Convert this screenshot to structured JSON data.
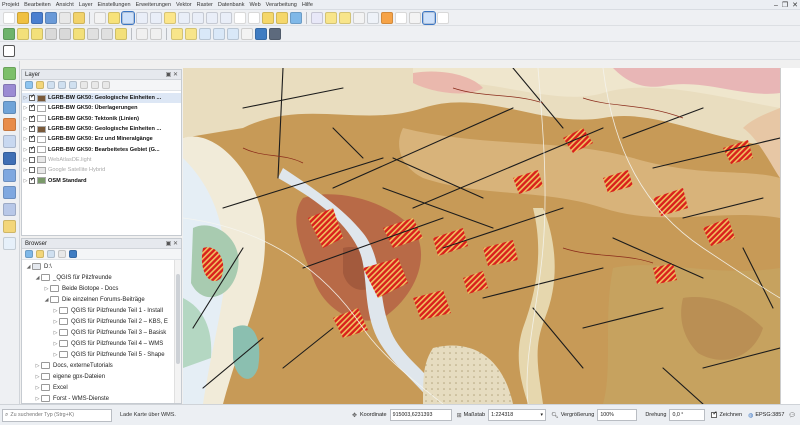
{
  "menu": [
    "Projekt",
    "Bearbeiten",
    "Ansicht",
    "Layer",
    "Einstellungen",
    "Erweiterungen",
    "Vektor",
    "Raster",
    "Datenbank",
    "Web",
    "Verarbeitung",
    "Hilfe"
  ],
  "window_controls": {
    "minimize": "–",
    "maximize": "❐",
    "close": "✕"
  },
  "layer_panel": {
    "title": "Layer",
    "controls": "▣ ✕",
    "layers": [
      {
        "label": "LGRB-BW GK50: Geologische Einheiten ...",
        "checked": true,
        "dim": false,
        "selected": true,
        "icon_color": "#7a5a3a"
      },
      {
        "label": "LGRB-BW GK50: Überlagerungen",
        "checked": true,
        "dim": false,
        "selected": false,
        "icon_color": "#ffffff"
      },
      {
        "label": "LGRB-BW GK50: Tektonik (Linien)",
        "checked": true,
        "dim": false,
        "selected": false,
        "icon_color": "#ffffff"
      },
      {
        "label": "LGRB-BW GK50: Geologische Einheiten ...",
        "checked": true,
        "dim": false,
        "selected": false,
        "icon_color": "#7a5a3a"
      },
      {
        "label": "LGRB-BW GK50: Erz und Mineralgänge",
        "checked": true,
        "dim": false,
        "selected": false,
        "icon_color": "#ffffff"
      },
      {
        "label": "LGRB-BW GK50: Bearbeitetes Gebiet (G...",
        "checked": true,
        "dim": false,
        "selected": false,
        "icon_color": "#ffffff"
      },
      {
        "label": "WebAtlasDE.light",
        "checked": false,
        "dim": true,
        "selected": false,
        "icon_color": "#e8e8e8"
      },
      {
        "label": "Google Satellite Hybrid",
        "checked": false,
        "dim": true,
        "selected": false,
        "icon_color": "#e8e8e8"
      },
      {
        "label": "OSM Standard",
        "checked": true,
        "dim": false,
        "selected": false,
        "icon_color": "#7a9a6a"
      }
    ]
  },
  "browser_panel": {
    "title": "Browser",
    "controls": "▣ ✕",
    "tree": [
      {
        "label": "D:\\",
        "level": 0,
        "twisty": "◢"
      },
      {
        "label": "_QGIS für Pilzfreunde",
        "level": 1,
        "twisty": "◢"
      },
      {
        "label": "Beide Biotope - Docs",
        "level": 2,
        "twisty": "▷"
      },
      {
        "label": "Die einzelnen Forums-Beiträge",
        "level": 2,
        "twisty": "◢"
      },
      {
        "label": "QGIS für Pilzfreunde Teil 1 - Install",
        "level": 3,
        "twisty": "▷"
      },
      {
        "label": "QGIS für Pilzfreunde Teil 2 – KBS, E",
        "level": 3,
        "twisty": "▷"
      },
      {
        "label": "QGIS für Pilzfreunde Teil 3 – Basisk",
        "level": 3,
        "twisty": "▷"
      },
      {
        "label": "QGIS für Pilzfreunde Teil 4 – WMS",
        "level": 3,
        "twisty": "▷"
      },
      {
        "label": "QGIS für Pilzfreunde Teil 5 - Shape",
        "level": 3,
        "twisty": "▷"
      },
      {
        "label": "Docs, externeTutorials",
        "level": 1,
        "twisty": "▷"
      },
      {
        "label": "eigene gpx-Dateien",
        "level": 1,
        "twisty": "▷"
      },
      {
        "label": "Excel",
        "level": 1,
        "twisty": "▷"
      },
      {
        "label": "Forst - WMS-Dienste",
        "level": 1,
        "twisty": "▷"
      }
    ]
  },
  "status": {
    "search_placeholder": "Zu suchender Typ (Strg+K)",
    "message": "Lade Karte über WMS.",
    "coord_label": "Koordinate",
    "coord_value": "915003,6231393",
    "scale_label": "Maßstab",
    "scale_value": "1:224318",
    "magnifier_label": "Vergrößerung",
    "magnifier_value": "100%",
    "rotation_label": "Drehung",
    "rotation_value": "0,0 °",
    "render_label": "Zeichnen",
    "crs": "EPSG:3857"
  },
  "colors": {
    "accent": "#3b76c4",
    "map_base": "#c9a25f",
    "map_red": "#d9201c"
  }
}
